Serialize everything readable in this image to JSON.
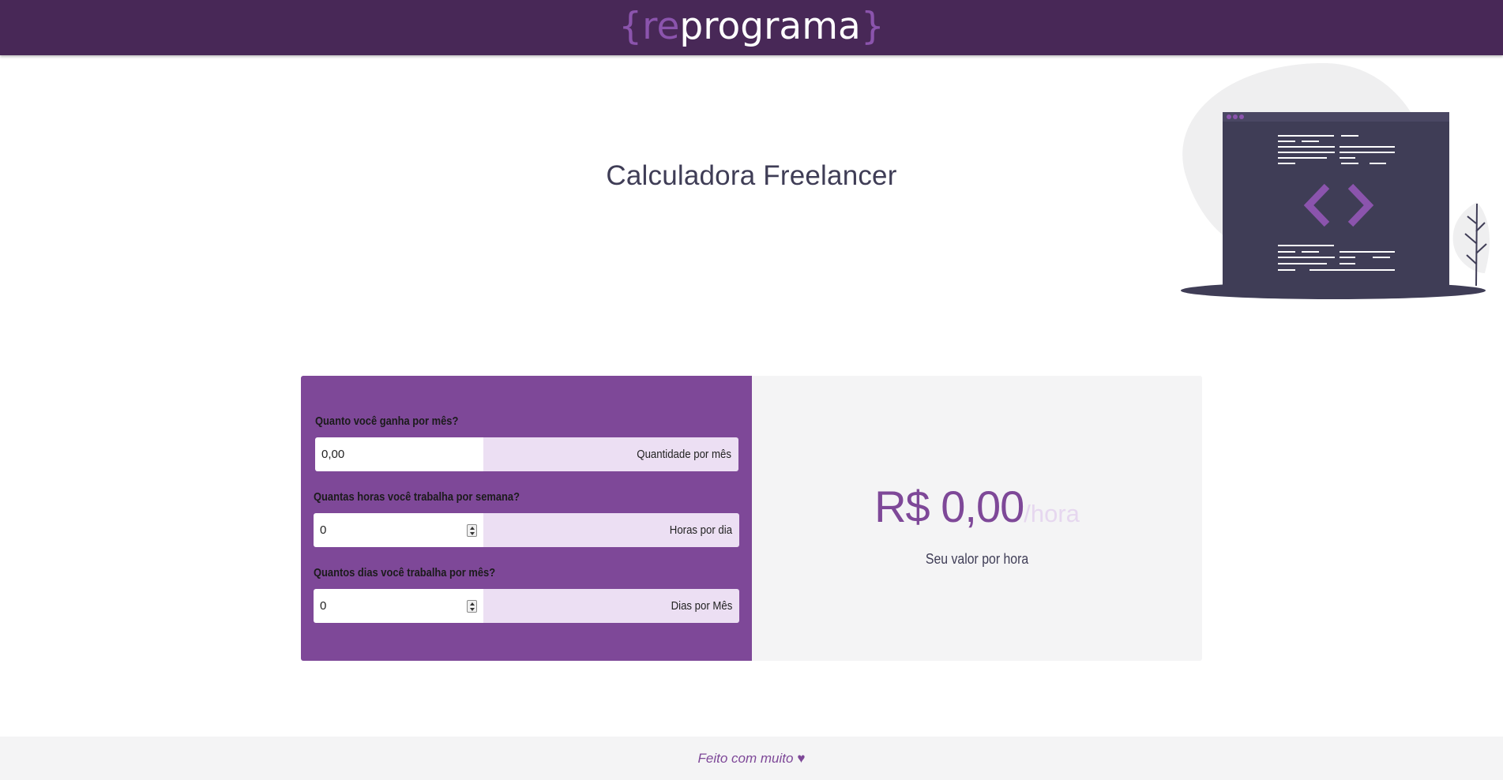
{
  "header": {
    "logo": {
      "brace_open": "{",
      "re": "re",
      "rest": "programa",
      "brace_close": "}"
    }
  },
  "page": {
    "title": "Calculadora Freelancer"
  },
  "form": {
    "monthly": {
      "label": "Quanto você ganha por mês?",
      "value": "0,00",
      "suffix": "Quantidade por mês"
    },
    "hours": {
      "label": "Quantas horas você trabalha por semana?",
      "value": "0",
      "suffix": "Horas por dia"
    },
    "days": {
      "label": "Quantos dias você trabalha por mês?",
      "value": "0",
      "suffix": "Dias por Mês"
    }
  },
  "result": {
    "amount": "R$ 0,00",
    "unit": "/hora",
    "caption": "Seu valor por hora"
  },
  "footer": {
    "text": "Feito com muito",
    "heart": "♥"
  },
  "colors": {
    "header_bg": "#482857",
    "accent": "#7e4898",
    "accent_light": "#ecdff3",
    "panel_bg": "#f4f4f5",
    "title_text": "#3f3d56"
  },
  "icons": [
    "code-window-illustration-icon",
    "plant-icon",
    "spinner-icon",
    "heart-icon"
  ]
}
